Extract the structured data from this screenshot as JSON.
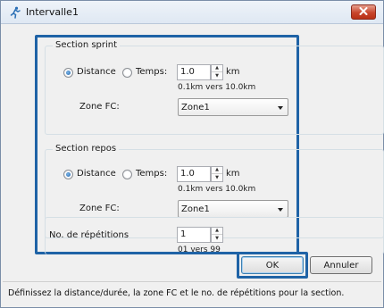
{
  "window": {
    "title": "Intervalle1",
    "icon": "runner-icon",
    "close_icon": "close-icon"
  },
  "sprint": {
    "title": "Section sprint",
    "distance_label": "Distance",
    "time_label": "Temps:",
    "selected": "distance",
    "value": "1.0",
    "unit": "km",
    "range_hint": "0.1km vers 10.0km",
    "zone_label": "Zone FC:",
    "zone_value": "Zone1"
  },
  "rest": {
    "title": "Section repos",
    "distance_label": "Distance",
    "time_label": "Temps:",
    "selected": "distance",
    "value": "1.0",
    "unit": "km",
    "range_hint": "0.1km vers 10.0km",
    "zone_label": "Zone FC:",
    "zone_value": "Zone1"
  },
  "repetitions": {
    "label": "No. de répétitions",
    "value": "1",
    "range_hint": "01 vers 99"
  },
  "buttons": {
    "ok": "OK",
    "cancel": "Annuler"
  },
  "status_text": "Définissez la distance/durée, la zone FC et le no. de répétitions pour la section.",
  "colors": {
    "highlight": "#1f63a6",
    "close_button": "#c8452c"
  }
}
